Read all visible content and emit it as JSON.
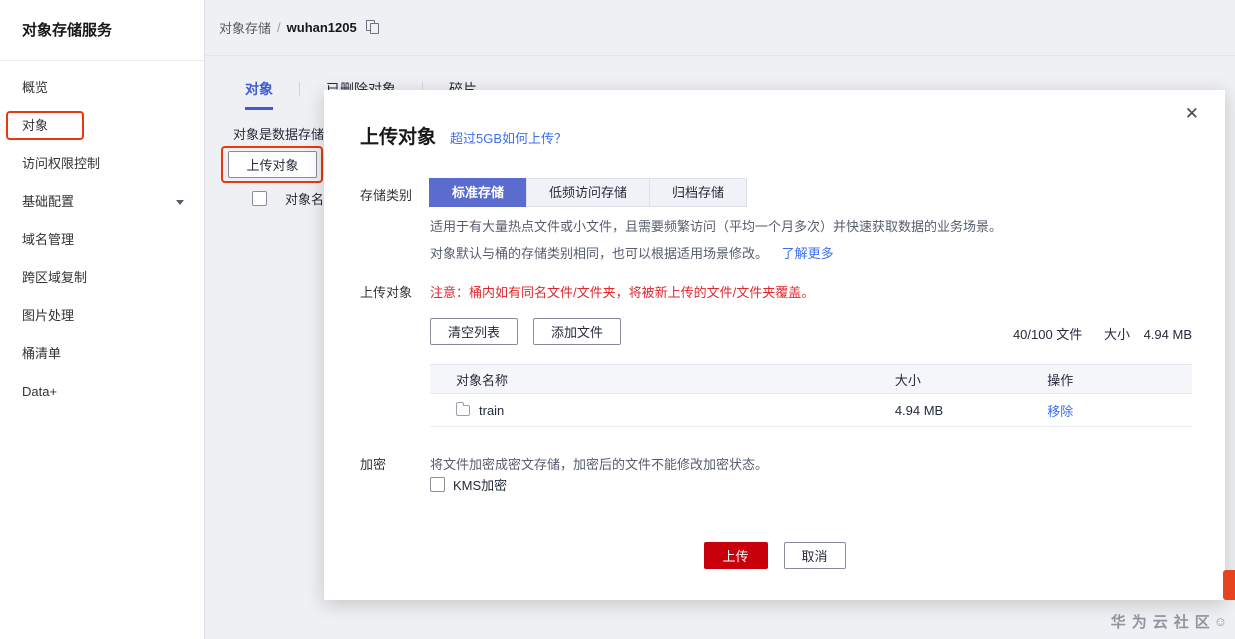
{
  "app": {
    "title": "对象存储服务"
  },
  "sidebar": {
    "items": [
      {
        "label": "概览"
      },
      {
        "label": "对象"
      },
      {
        "label": "访问权限控制"
      },
      {
        "label": "基础配置"
      },
      {
        "label": "域名管理"
      },
      {
        "label": "跨区域复制"
      },
      {
        "label": "图片处理"
      },
      {
        "label": "桶清单"
      },
      {
        "label": "Data+"
      }
    ]
  },
  "breadcrumb": {
    "root": "对象存储",
    "separator": "/",
    "current": "wuhan1205"
  },
  "tabs": {
    "object": "对象",
    "deleted": "已删除对象",
    "fragment": "碎片"
  },
  "page_behind": {
    "partial_text": "对象是数据存储的",
    "upload_button": "上传对象",
    "partial_column": "对象名"
  },
  "modal": {
    "title": "上传对象",
    "help_link": "超过5GB如何上传？",
    "close": "✕",
    "storage": {
      "label": "存储类别",
      "selected": "标准存储",
      "options": [
        {
          "label": "标准存储"
        },
        {
          "label": "低频访问存储"
        },
        {
          "label": "归档存储"
        }
      ],
      "desc1": "适用于有大量热点文件或小文件，且需要频繁访问（平均一个月多次）并快速获取数据的业务场景。",
      "desc2": "对象默认与桶的存储类别相同，也可以根据适用场景修改。",
      "learn_more": "了解更多"
    },
    "upload": {
      "label": "上传对象",
      "warning": "注意：桶内如有同名文件/文件夹，将被新上传的文件/文件夹覆盖。",
      "clear_list": "清空列表",
      "add_files": "添加文件",
      "file_count": "40/100 文件",
      "size_label": "大小",
      "size_value": "4.94 MB",
      "table": {
        "headers": [
          "对象名称",
          "大小",
          "操作"
        ],
        "rows": [
          {
            "name": "train",
            "size": "4.94 MB",
            "action": "移除"
          }
        ]
      }
    },
    "encryption": {
      "label": "加密",
      "desc": "将文件加密成密文存储，加密后的文件不能修改加密状态。",
      "kms": "KMS加密",
      "checked": false
    },
    "footer": {
      "upload": "上传",
      "cancel": "取消"
    }
  },
  "watermark": {
    "text": "华为云社区",
    "emoji": "☺"
  },
  "colors": {
    "brand_red": "#c7000b",
    "link_blue": "#3d6ff0",
    "tab_blue": "#3d5cd2",
    "segment_selected_blue": "#5a6dce",
    "warning_red": "#e0282e",
    "annotation_red": "#e8380d"
  }
}
